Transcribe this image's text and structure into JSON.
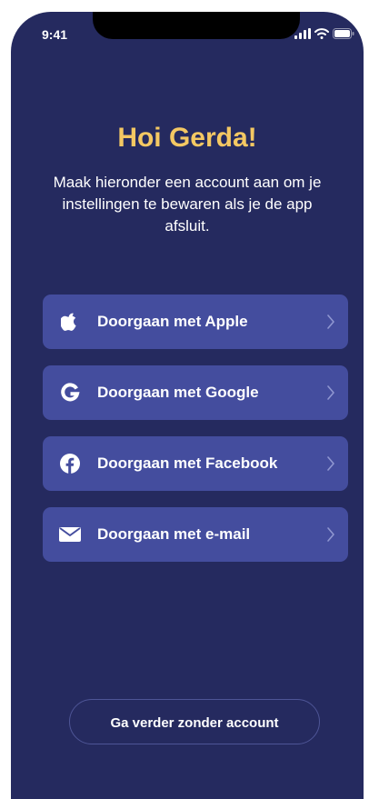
{
  "status_bar": {
    "time": "9:41",
    "icons": [
      "cellular-signal-icon",
      "wifi-icon",
      "battery-icon"
    ]
  },
  "greeting": {
    "title": "Hoi Gerda!",
    "subtitle": "Maak hieronder een account aan om je instellingen te bewaren als je de app afsluit."
  },
  "auth_options": [
    {
      "label": "Doorgaan met Apple",
      "icon": "apple-icon"
    },
    {
      "label": "Doorgaan met Google",
      "icon": "google-icon"
    },
    {
      "label": "Doorgaan met Facebook",
      "icon": "facebook-icon"
    },
    {
      "label": "Doorgaan met e-mail",
      "icon": "mail-icon"
    }
  ],
  "skip": {
    "label": "Ga verder zonder account"
  },
  "colors": {
    "background": "#252a5f",
    "button": "#444d9e",
    "accent": "#f4c863",
    "text": "#ffffff"
  }
}
